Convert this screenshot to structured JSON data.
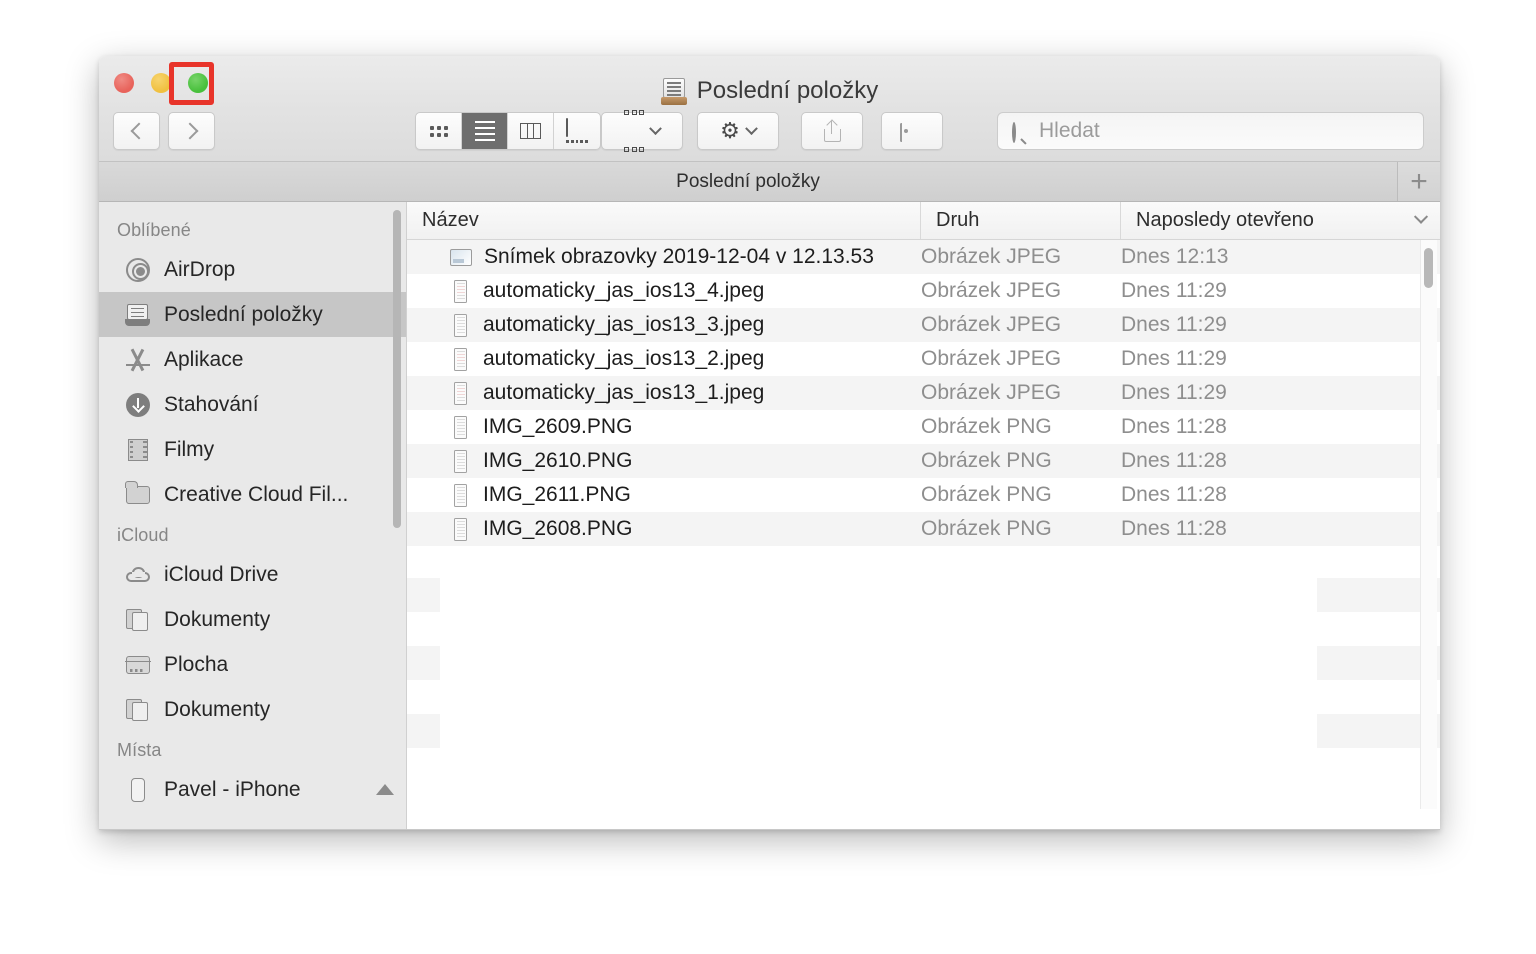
{
  "window": {
    "title": "Poslední položky",
    "title_icon": "recents-icon",
    "traffic_lights": [
      {
        "name": "close",
        "color": "#e8635b"
      },
      {
        "name": "minimize",
        "color": "#f0c040"
      },
      {
        "name": "maximize",
        "color": "#48c03c"
      }
    ],
    "highlight_color": "#e8342a",
    "highlighted_control": "maximize"
  },
  "toolbar": {
    "back_label": "‹",
    "forward_label": "›",
    "view_modes": [
      {
        "name": "icon-view",
        "active": false
      },
      {
        "name": "list-view",
        "active": true
      },
      {
        "name": "column-view",
        "active": false
      },
      {
        "name": "gallery-view",
        "active": false
      }
    ],
    "arrange_label": "",
    "action_label": "",
    "share_label": "",
    "tags_label": ""
  },
  "search": {
    "placeholder": "Hledat",
    "value": ""
  },
  "tabbar": {
    "tabs": [
      {
        "label": "Poslední položky",
        "active": true
      }
    ],
    "new_tab_label": "+"
  },
  "sidebar": {
    "sections": [
      {
        "title": "Oblíbené",
        "items": [
          {
            "label": "AirDrop",
            "icon": "airdrop-icon",
            "selected": false
          },
          {
            "label": "Poslední položky",
            "icon": "recents-icon",
            "selected": true
          },
          {
            "label": "Aplikace",
            "icon": "apps-icon",
            "selected": false
          },
          {
            "label": "Stahování",
            "icon": "download-icon",
            "selected": false
          },
          {
            "label": "Filmy",
            "icon": "movie-icon",
            "selected": false
          },
          {
            "label": "Creative Cloud Fil...",
            "icon": "folder-icon",
            "selected": false
          }
        ]
      },
      {
        "title": "iCloud",
        "items": [
          {
            "label": "iCloud Drive",
            "icon": "cloud-icon",
            "selected": false
          },
          {
            "label": "Dokumenty",
            "icon": "documents-icon",
            "selected": false
          },
          {
            "label": "Plocha",
            "icon": "desktop-icon",
            "selected": false
          },
          {
            "label": "Dokumenty",
            "icon": "documents-icon",
            "selected": false
          }
        ]
      },
      {
        "title": "Místa",
        "items": [
          {
            "label": "Pavel - iPhone",
            "icon": "iphone-icon",
            "selected": false,
            "eject": true
          }
        ]
      }
    ]
  },
  "file_list": {
    "columns": [
      {
        "key": "name",
        "label": "Název"
      },
      {
        "key": "kind",
        "label": "Druh"
      },
      {
        "key": "date",
        "label": "Naposledy otevřeno",
        "sorted": true,
        "sort_icon": "chevron-down-icon"
      }
    ],
    "rows": [
      {
        "name": "Snímek obrazovky 2019-12-04 v 12.13.53",
        "kind": "Obrázek JPEG",
        "date": "Dnes 12:13",
        "thumb": "screenshot-landscape"
      },
      {
        "name": "automaticky_jas_ios13_4.jpeg",
        "kind": "Obrázek JPEG",
        "date": "Dnes 11:29",
        "thumb": "screenshot-portrait-pink"
      },
      {
        "name": "automaticky_jas_ios13_3.jpeg",
        "kind": "Obrázek JPEG",
        "date": "Dnes 11:29",
        "thumb": "screenshot-portrait"
      },
      {
        "name": "automaticky_jas_ios13_2.jpeg",
        "kind": "Obrázek JPEG",
        "date": "Dnes 11:29",
        "thumb": "screenshot-portrait-pink"
      },
      {
        "name": "automaticky_jas_ios13_1.jpeg",
        "kind": "Obrázek JPEG",
        "date": "Dnes 11:29",
        "thumb": "screenshot-portrait-pink"
      },
      {
        "name": "IMG_2609.PNG",
        "kind": "Obrázek PNG",
        "date": "Dnes 11:28",
        "thumb": "screenshot-portrait"
      },
      {
        "name": "IMG_2610.PNG",
        "kind": "Obrázek PNG",
        "date": "Dnes 11:28",
        "thumb": "screenshot-portrait"
      },
      {
        "name": "IMG_2611.PNG",
        "kind": "Obrázek PNG",
        "date": "Dnes 11:28",
        "thumb": "screenshot-portrait"
      },
      {
        "name": "IMG_2608.PNG",
        "kind": "Obrázek PNG",
        "date": "Dnes 11:28",
        "thumb": "screenshot-portrait"
      }
    ]
  }
}
